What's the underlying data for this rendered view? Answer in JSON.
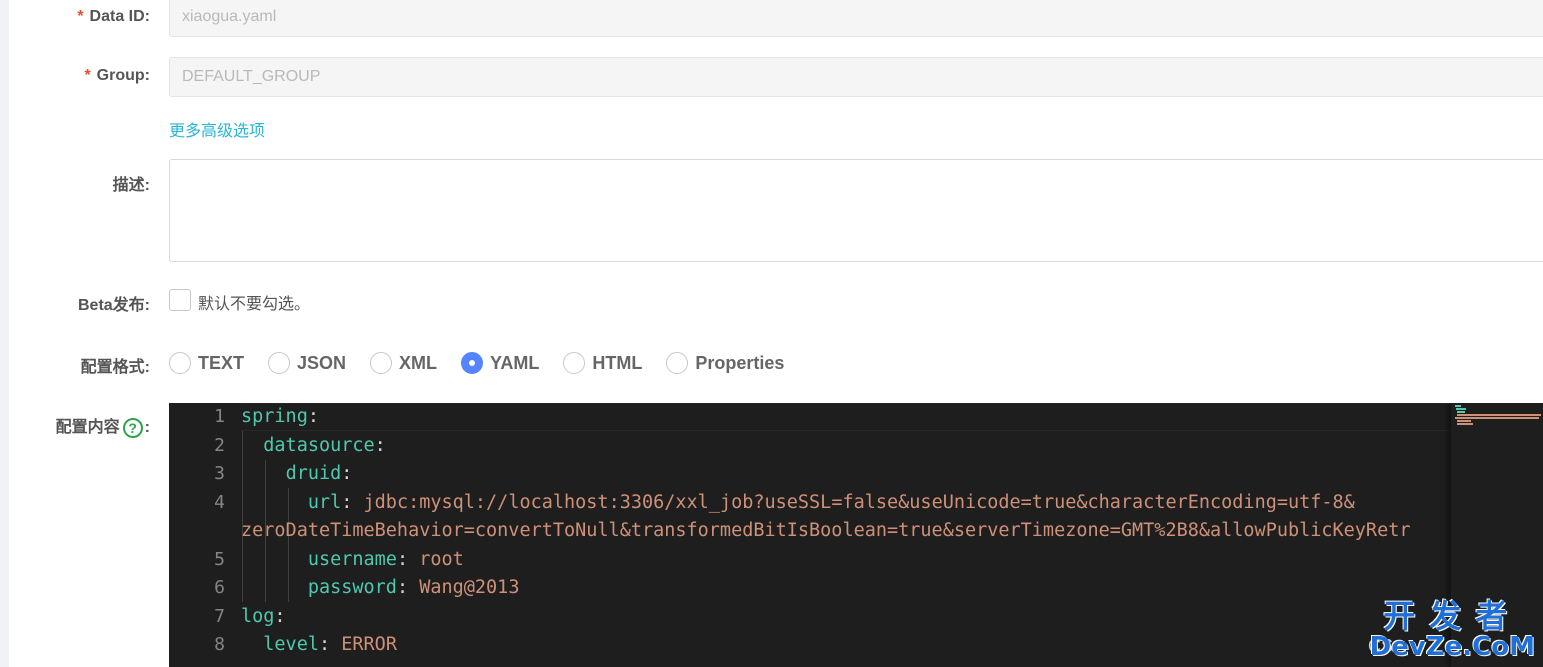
{
  "form": {
    "data_id": {
      "required_mark": "*",
      "label": "Data ID:",
      "value": "xiaogua.yaml"
    },
    "group": {
      "required_mark": "*",
      "label": "Group:",
      "value": "DEFAULT_GROUP"
    },
    "advanced_link": "更多高级选项",
    "description": {
      "label": "描述:",
      "value": ""
    },
    "beta": {
      "label": "Beta发布:",
      "checkbox_text": "默认不要勾选。",
      "checked": false
    },
    "format": {
      "label": "配置格式:",
      "options": [
        "TEXT",
        "JSON",
        "XML",
        "YAML",
        "HTML",
        "Properties"
      ],
      "selected": "YAML"
    },
    "content": {
      "label": "配置内容",
      "help_icon_text": "?",
      "label_suffix": ":"
    }
  },
  "editor": {
    "line_numbers": [
      "1",
      "2",
      "3",
      "4",
      "5",
      "6",
      "7",
      "8"
    ],
    "lines": [
      {
        "indent": "",
        "key": "spring",
        "sep": ":",
        "value": ""
      },
      {
        "indent": "  ",
        "key": "datasource",
        "sep": ":",
        "value": ""
      },
      {
        "indent": "    ",
        "key": "druid",
        "sep": ":",
        "value": ""
      },
      {
        "indent": "      ",
        "key": "url",
        "sep": ": ",
        "value": "jdbc:mysql://localhost:3306/xxl_job?useSSL=false&useUnicode=true&characterEncoding=utf-8&"
      },
      {
        "indent": "",
        "key": "",
        "sep": "",
        "value": "zeroDateTimeBehavior=convertToNull&transformedBitIsBoolean=true&serverTimezone=GMT%2B8&allowPublicKeyRetr"
      },
      {
        "indent": "      ",
        "key": "username",
        "sep": ": ",
        "value": "root"
      },
      {
        "indent": "      ",
        "key": "password",
        "sep": ": ",
        "value": "Wang@2013"
      },
      {
        "indent": "",
        "key": "log",
        "sep": ":",
        "value": ""
      },
      {
        "indent": "  ",
        "key": "level",
        "sep": ": ",
        "value": "ERROR"
      }
    ],
    "colors": {
      "background": "#1e1e1e",
      "key": "#4ec9b0",
      "value": "#ce9178",
      "line_number": "#858585"
    }
  },
  "watermark": {
    "top": "开发者",
    "bottom": "DevZe.CoM",
    "csdn_prefix": "CS"
  },
  "colors": {
    "link": "#2bb6d6",
    "required": "#e84c2c",
    "radio_selected": "#5584ff",
    "help_icon": "#2ea44f"
  }
}
